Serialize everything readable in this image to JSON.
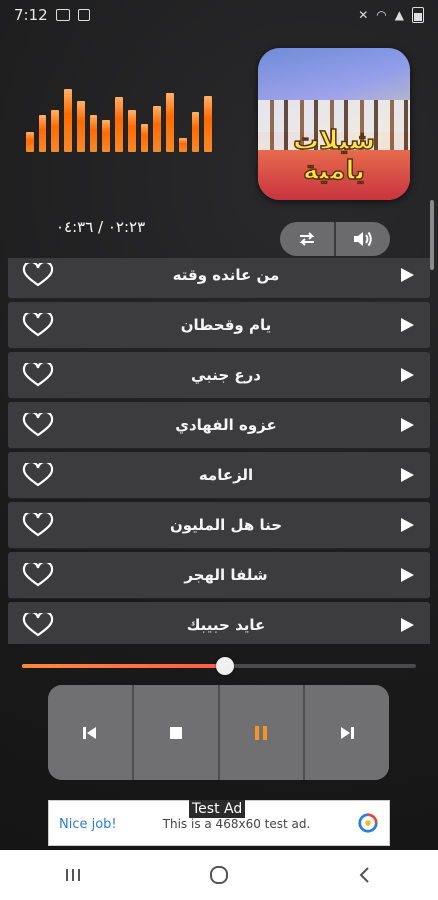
{
  "status_bar": {
    "time": "7:12",
    "icons_left": [
      "image-icon",
      "bag-icon"
    ],
    "icons_right": [
      "mute-icon",
      "wifi-icon",
      "signal-icon",
      "battery-icon"
    ]
  },
  "visualizer": {
    "levels": [
      0.32,
      0.58,
      0.66,
      0.98,
      0.8,
      0.58,
      0.5,
      0.86,
      0.65,
      0.44,
      0.72,
      0.92,
      0.22,
      0.62,
      0.88
    ]
  },
  "album": {
    "title": "شيلات يامية"
  },
  "player": {
    "time_text": "٠٢:٢٣ / ٠٤:٣٦",
    "progress": 0.52
  },
  "songs": [
    {
      "title": "من عانده وقته"
    },
    {
      "title": "يام وقحطان"
    },
    {
      "title": "درع جنبي"
    },
    {
      "title": "عزوه الفهادي"
    },
    {
      "title": "الزعامه"
    },
    {
      "title": "حنا هل المليون"
    },
    {
      "title": "شلفا الهجر"
    },
    {
      "title": "عايد حبيبك"
    }
  ],
  "controls": {
    "repeat_icon": "repeat-icon",
    "volume_icon": "volume-icon"
  },
  "transport": {
    "buttons": [
      "previous-icon",
      "stop-icon",
      "pause-icon",
      "next-icon"
    ],
    "accent": "#f5922a"
  },
  "ad": {
    "label": "Test Ad",
    "nice_text": "Nice job!",
    "body_text": "This is a 468x60 test ad."
  }
}
